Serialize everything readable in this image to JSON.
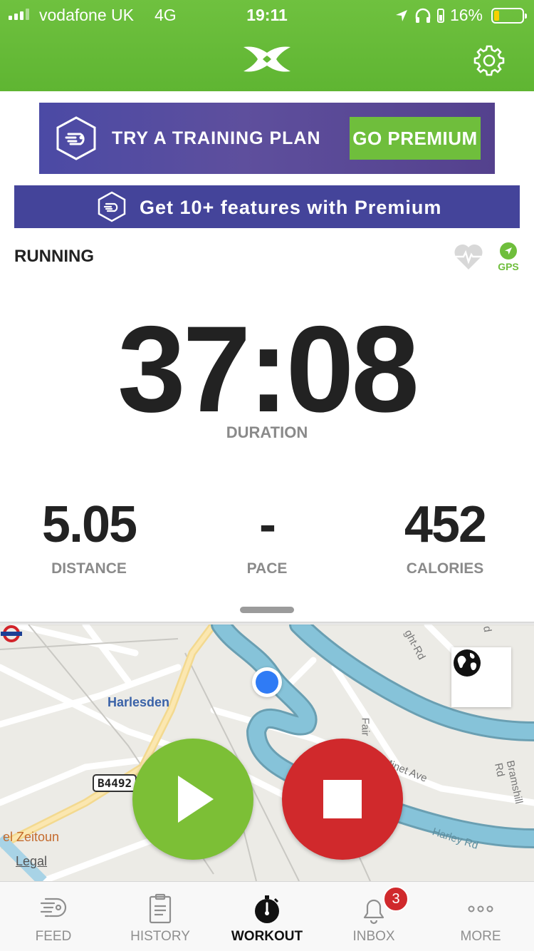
{
  "status_bar": {
    "carrier": "vodafone UK",
    "network": "4G",
    "time": "19:11",
    "battery": "16%",
    "icons": [
      "signal-icon",
      "location-arrow-icon",
      "headphones-icon",
      "battery-icon"
    ]
  },
  "nav": {
    "logo": "under-armour-logo",
    "settings_icon": "gear-icon"
  },
  "promo_banner": {
    "text": "TRY A TRAINING PLAN",
    "button": "GO PREMIUM"
  },
  "premium_bar": {
    "text": "Get 10+ features with Premium"
  },
  "activity": {
    "type": "RUNNING",
    "gps_label": "GPS",
    "icons": [
      "heart-rate-icon",
      "gps-icon"
    ]
  },
  "stats": {
    "duration_value": "37:08",
    "duration_label": "DURATION",
    "distance_value": "5.05",
    "distance_label": "DISTANCE",
    "pace_value": "-",
    "pace_label": "PACE",
    "calories_value": "452",
    "calories_label": "CALORIES"
  },
  "map": {
    "station": "Harlesden",
    "road_badge": "B4492",
    "place_el_zeitoun": "el Zeitoun",
    "legal": "Legal",
    "streets": {
      "fairlight": "ght-Rd",
      "fair": "Fair",
      "minet": "Minet Ave",
      "harley": "Harley Rd",
      "bramshill": "Bramshill Rd",
      "top_right": "d"
    }
  },
  "controls": {
    "play": "play-icon",
    "stop": "stop-icon"
  },
  "tab_bar": {
    "tabs": [
      {
        "label": "FEED",
        "icon": "feed-icon"
      },
      {
        "label": "HISTORY",
        "icon": "history-clipboard-icon"
      },
      {
        "label": "WORKOUT",
        "icon": "stopwatch-icon",
        "active": true
      },
      {
        "label": "INBOX",
        "icon": "bell-icon",
        "badge": "3"
      },
      {
        "label": "MORE",
        "icon": "more-dots-icon"
      }
    ]
  },
  "colors": {
    "brand_green": "#6fbe3c",
    "premium_blue": "#44449a",
    "stop_red": "#d0292c",
    "water": "#79bfd6"
  }
}
